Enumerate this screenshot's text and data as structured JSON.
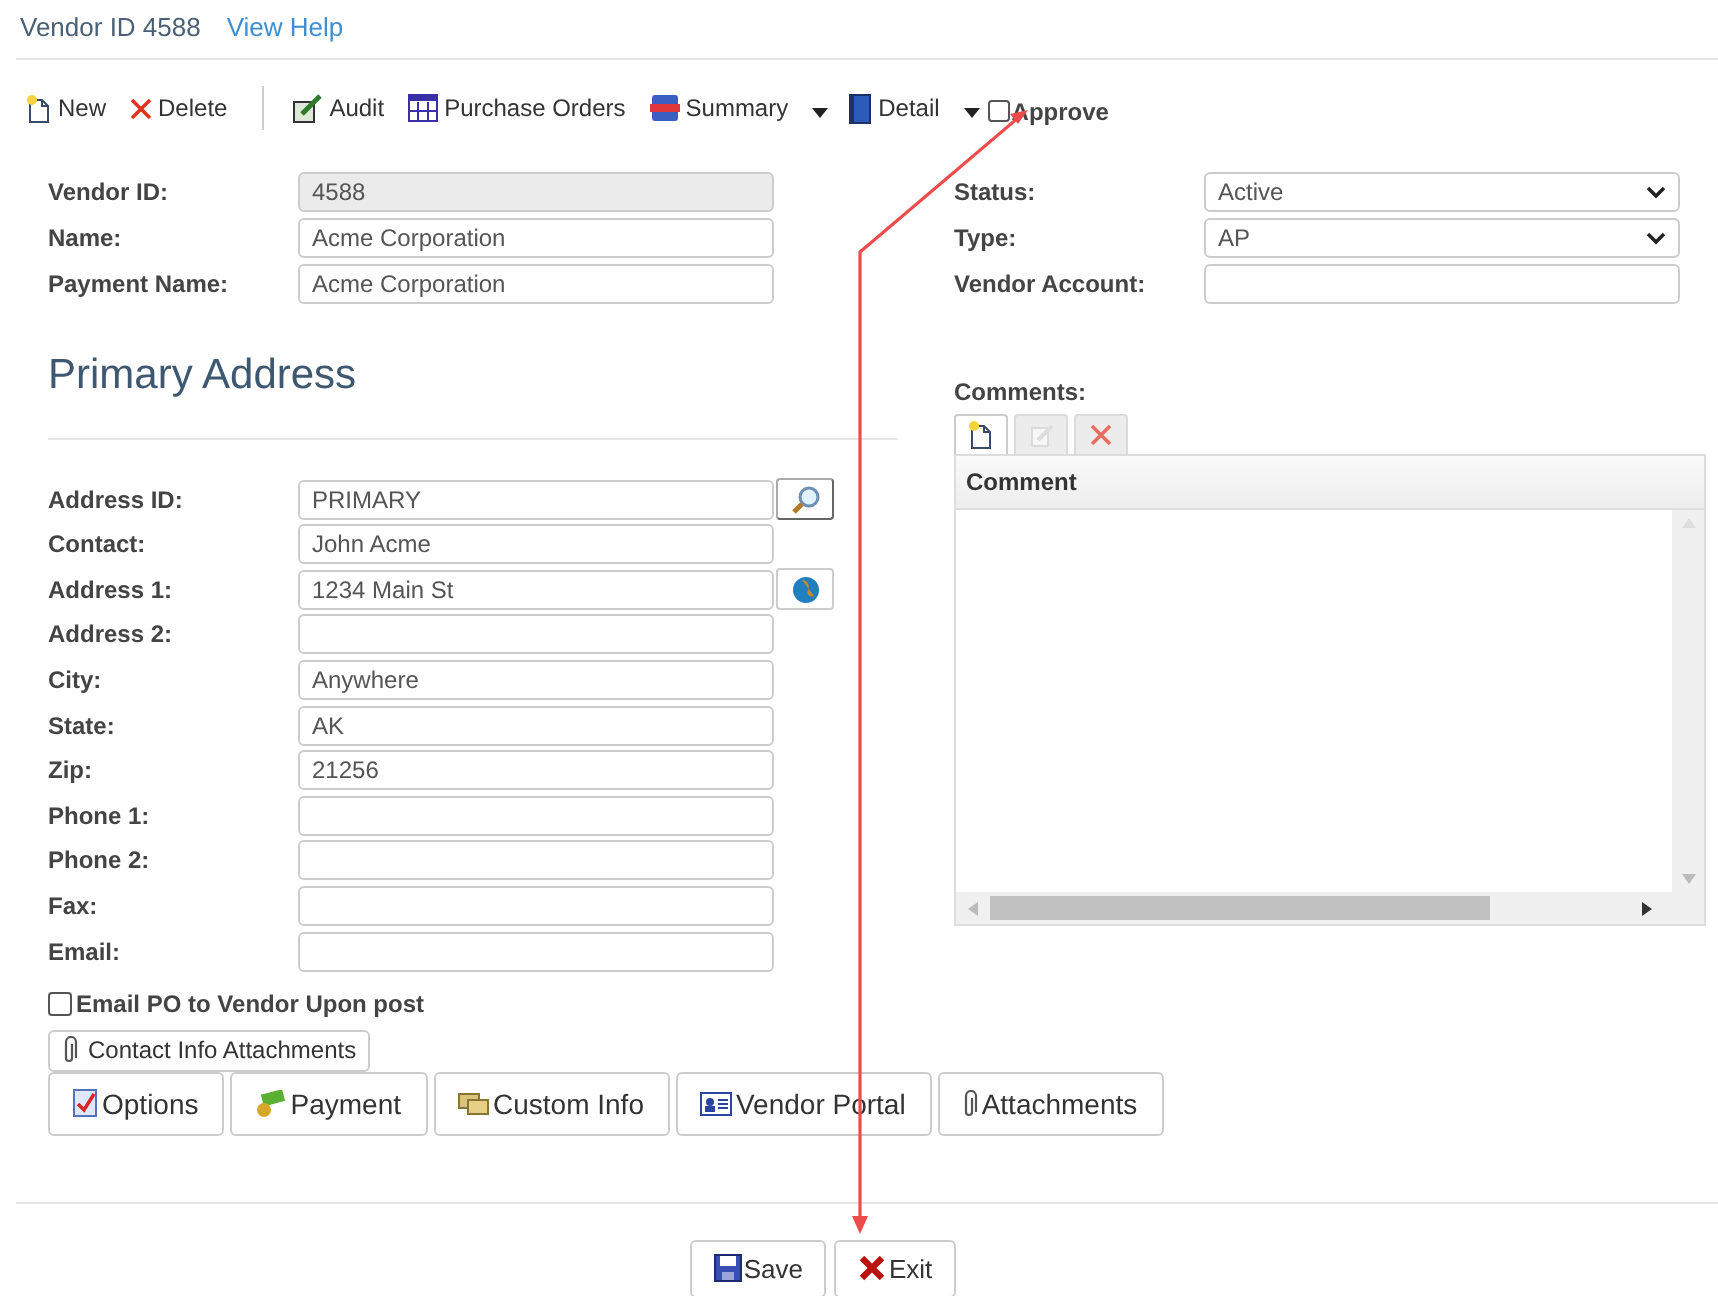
{
  "header": {
    "title": "Vendor ID 4588",
    "help_link": "View Help"
  },
  "toolbar": [
    {
      "kind": "button",
      "label": "New"
    },
    {
      "kind": "button",
      "label": "Delete"
    },
    {
      "kind": "separator"
    },
    {
      "kind": "button",
      "label": "Audit"
    },
    {
      "kind": "button",
      "label": "Purchase Orders"
    },
    {
      "kind": "dropdown",
      "label": "Summary"
    },
    {
      "kind": "dropdown",
      "label": "Detail"
    },
    {
      "kind": "checkbox",
      "label": "Approve",
      "checked": false
    }
  ],
  "vendor_fields": [
    {
      "label": "Vendor ID:",
      "kind": "readonly",
      "value": "4588"
    },
    {
      "label": "Name:",
      "kind": "text",
      "value": "Acme Corporation"
    },
    {
      "label": "Payment Name:",
      "kind": "text",
      "value": "Acme Corporation"
    }
  ],
  "status_fields": [
    {
      "label": "Status:",
      "kind": "select",
      "value": "Active"
    },
    {
      "label": "Type:",
      "kind": "select",
      "value": "AP"
    },
    {
      "label": "Vendor Account:",
      "kind": "text"
    }
  ],
  "section_title": "Primary Address",
  "address_fields": [
    {
      "label": "Address ID:",
      "kind": "lookup",
      "value": "PRIMARY"
    },
    {
      "label": "Contact:",
      "kind": "text",
      "value": "John Acme"
    },
    {
      "label": "Address 1:",
      "kind": "locate",
      "value": "1234 Main St"
    },
    {
      "label": "Address 2:",
      "kind": "text"
    },
    {
      "label": "City:",
      "kind": "text",
      "value": "Anywhere"
    },
    {
      "label": "State:",
      "kind": "text",
      "value": "AK"
    },
    {
      "label": "Zip:",
      "kind": "text",
      "value": "21256"
    },
    {
      "label": "Phone 1:",
      "kind": "text"
    },
    {
      "label": "Phone 2:",
      "kind": "text"
    },
    {
      "label": "Fax:",
      "kind": "text"
    },
    {
      "label": "Email:",
      "kind": "text"
    }
  ],
  "comments": {
    "label": "Comments:",
    "tools": [
      {
        "disabled": false
      },
      {
        "disabled": true
      },
      {
        "disabled": true
      }
    ],
    "columns": [
      "Comment"
    ]
  },
  "email_po": {
    "label": "Email PO to Vendor Upon post",
    "checked": false
  },
  "contact_attachments": "Contact Info Attachments",
  "section_buttons": [
    "Options",
    "Payment",
    "Custom Info",
    "Vendor Portal",
    "Attachments"
  ],
  "footer_buttons": [
    "Save",
    "Exit"
  ]
}
